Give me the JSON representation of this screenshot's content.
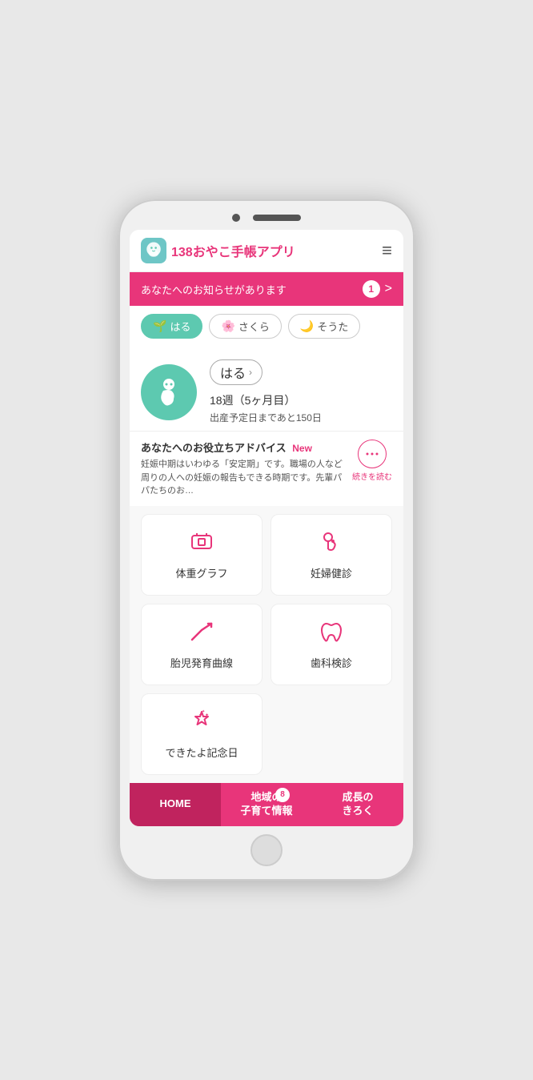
{
  "app": {
    "title": "138おやこ手帳アプリ",
    "logo_text": "138",
    "hamburger_label": "≡"
  },
  "notification": {
    "text": "あなたへのお知らせがあります",
    "badge": "1",
    "arrow": ">"
  },
  "child_tabs": [
    {
      "id": "haru",
      "name": "はる",
      "active": true
    },
    {
      "id": "sakura",
      "name": "さくら",
      "active": false
    },
    {
      "id": "souta",
      "name": "そうた",
      "active": false
    }
  ],
  "profile": {
    "name": "はる",
    "weeks": "18",
    "weeks_unit": "週",
    "months": "（5ヶ月目）",
    "due_text": "出産予定日まであと150日"
  },
  "advice": {
    "title": "あなたへのお役立ちアドバイス",
    "new_badge": "New",
    "text": "妊娠中期はいわゆる「安定期」です。職場の人など周りの人への妊娠の報告もできる時期です。先輩パパたちのお…",
    "read_more_label": "続きを読む"
  },
  "features": [
    {
      "id": "weight",
      "label": "体重グラフ",
      "icon": "⊟"
    },
    {
      "id": "checkup",
      "label": "妊婦健診",
      "icon": "♡"
    },
    {
      "id": "growth",
      "label": "胎児発育曲線",
      "icon": "↗"
    },
    {
      "id": "dental",
      "label": "歯科検診",
      "icon": "🦷"
    },
    {
      "id": "milestone",
      "label": "できたよ記念日",
      "icon": "✦"
    }
  ],
  "bottom_nav": [
    {
      "id": "home",
      "label": "HOME",
      "active": true
    },
    {
      "id": "local",
      "label": "地域の\n子育て情報",
      "badge": "8",
      "active": false
    },
    {
      "id": "growth",
      "label": "成長の\nきろく",
      "active": false
    }
  ]
}
